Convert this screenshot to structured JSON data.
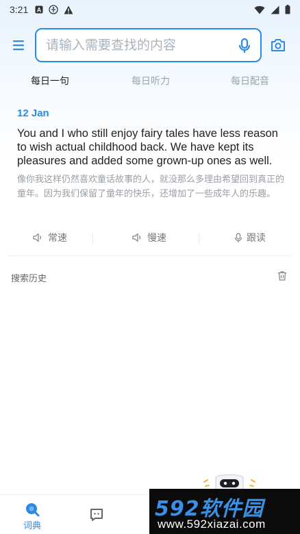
{
  "status_bar": {
    "time": "3:21",
    "left_icons": [
      "a-notification-icon",
      "accessibility-icon",
      "warning-icon"
    ],
    "right_icons": [
      "wifi-icon",
      "signal-icon",
      "battery-icon"
    ]
  },
  "search": {
    "placeholder": "请输入需要查找的内容",
    "value": ""
  },
  "tabs": [
    {
      "label": "每日一句",
      "active": true
    },
    {
      "label": "每日听力",
      "active": false
    },
    {
      "label": "每日配音",
      "active": false
    }
  ],
  "daily": {
    "date": "12 Jan",
    "sentence_en": "You and I who still enjoy fairy tales have less reason to wish actual childhood back. We have kept its pleasures and added some grown-up ones as well.",
    "sentence_cn": "像你我这样仍然喜欢童话故事的人，就没那么多理由希望回到真正的童年。因为我们保留了童年的快乐，还增加了一些成年人的乐趣。"
  },
  "audio": {
    "normal_label": "常速",
    "slow_label": "慢速",
    "follow_label": "跟读"
  },
  "history": {
    "title": "搜索历史"
  },
  "bottom_nav": {
    "dictionary_label": "词典"
  },
  "watermark": {
    "main_digits": "592",
    "main_cn": "软件园",
    "sub": "www.592xiazai.com"
  },
  "colors": {
    "accent": "#2a8ae6",
    "muted": "#9a9fa6",
    "watermark_bg": "#0b0b0b"
  }
}
